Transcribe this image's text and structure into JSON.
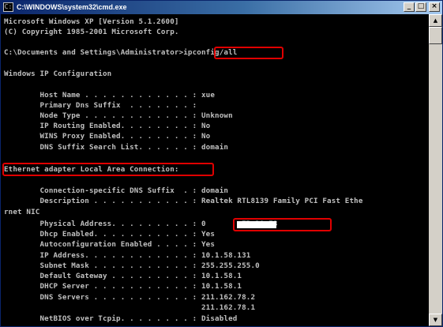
{
  "window": {
    "title": "C:\\WINDOWS\\system32\\cmd.exe",
    "minimize_glyph": "_",
    "maximize_glyph": "□",
    "close_glyph": "×",
    "icon": "cmd-console-icon"
  },
  "console_lines": [
    "Microsoft Windows XP [Version 5.1.2600]",
    "(C) Copyright 1985-2001 Microsoft Corp.",
    "",
    "C:\\Documents and Settings\\Administrator>ipconfig/all",
    "",
    "Windows IP Configuration",
    "",
    "        Host Name . . . . . . . . . . . . : xue",
    "        Primary Dns Suffix  . . . . . . . :",
    "        Node Type . . . . . . . . . . . . : Unknown",
    "        IP Routing Enabled. . . . . . . . : No",
    "        WINS Proxy Enabled. . . . . . . . : No",
    "        DNS Suffix Search List. . . . . . : domain",
    "",
    "Ethernet adapter Local Area Connection:",
    "",
    "        Connection-specific DNS Suffix  . : domain",
    "        Description . . . . . . . . . . . : Realtek RTL8139 Family PCI Fast Ethe",
    "rnet NIC",
    "        Physical Address. . . . . . . . . : 0        7B-2A-E3",
    "        Dhcp Enabled. . . . . . . . . . . : Yes",
    "        Autoconfiguration Enabled . . . . : Yes",
    "        IP Address. . . . . . . . . . . . : 10.1.58.131",
    "        Subnet Mask . . . . . . . . . . . : 255.255.255.0",
    "        Default Gateway . . . . . . . . . : 10.1.58.1",
    "        DHCP Server . . . . . . . . . . . : 10.1.58.1",
    "        DNS Servers . . . . . . . . . . . : 211.162.78.2",
    "                                            211.162.78.1",
    "        NetBIOS over Tcpip. . . . . . . . : Disabled"
  ],
  "colors": {
    "console_background": "#000000",
    "console_text": "#c0c0c0",
    "highlight_border": "#e00000",
    "titlebar_start": "#0a246a",
    "titlebar_end": "#a6caf0"
  },
  "scrollbar": {
    "up_glyph": "▲",
    "down_glyph": "▼"
  }
}
